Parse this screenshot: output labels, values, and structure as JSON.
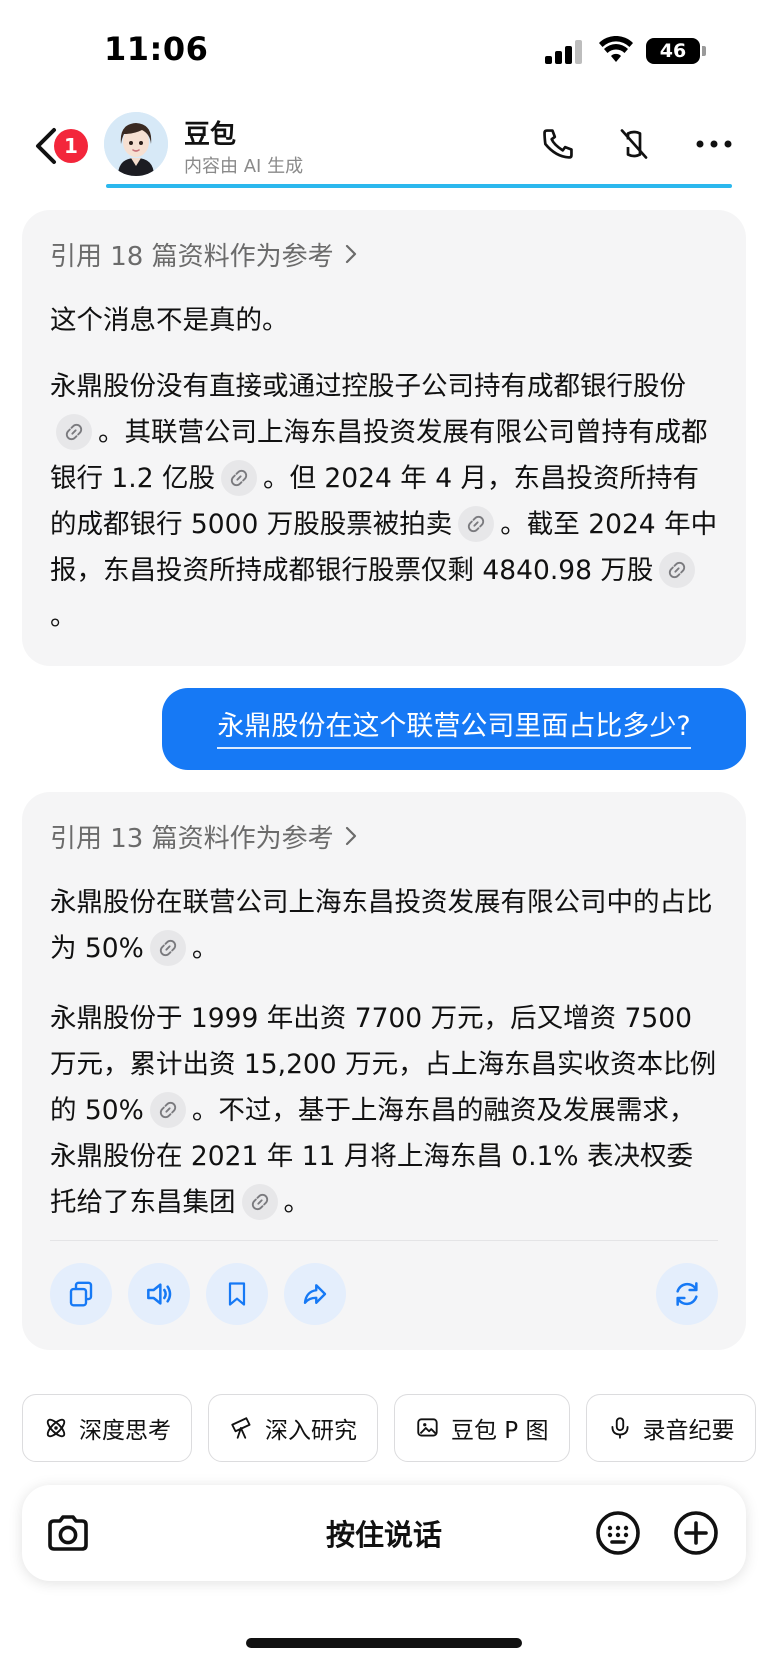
{
  "status_bar": {
    "time": "11:06",
    "battery": "46"
  },
  "header": {
    "unread_count": "1",
    "bot_name": "豆包",
    "subtitle": "内容由 AI 生成"
  },
  "messages": [
    {
      "role": "assistant",
      "reference": "引用 18 篇资料作为参考",
      "paragraphs": [
        {
          "segments": [
            "这个消息不是真的。"
          ]
        },
        {
          "segments": [
            "永鼎股份没有直接或通过控股子公司持有成都银行股份",
            "。其联营公司上海东昌投资发展有限公司曾持有成都银行 1.2 亿股",
            "。但 2024 年 4 月，东昌投资所持有的成都银行 5000 万股股票被拍卖",
            "。截至 2024 年中报，东昌投资所持成都银行股票仅剩 4840.98 万股",
            "。"
          ]
        }
      ]
    },
    {
      "role": "user",
      "text": "永鼎股份在这个联营公司里面占比多少?"
    },
    {
      "role": "assistant",
      "reference": "引用 13 篇资料作为参考",
      "paragraphs": [
        {
          "segments": [
            "永鼎股份在联营公司上海东昌投资发展有限公司中的占比为 50%",
            "。"
          ]
        },
        {
          "segments": [
            "永鼎股份于 1999 年出资 7700 万元，后又增资 7500 万元，累计出资 15,200 万元，占上海东昌实收资本比例的 50%",
            "。不过，基于上海东昌的融资及发展需求，永鼎股份在 2021 年 11 月将上海东昌 0.1% 表决权委托给了东昌集团",
            "。"
          ]
        }
      ]
    }
  ],
  "quick_tools": [
    "深度思考",
    "深入研究",
    "豆包 P 图",
    "录音纪要"
  ],
  "input_bar": {
    "hold_to_talk": "按住说话"
  },
  "colors": {
    "accent": "#1679f5",
    "bubble_bg": "#f5f5f6",
    "badge": "#f3263b",
    "progress": "#2bb8ee"
  },
  "icons": [
    "back-icon",
    "phone-icon",
    "mute-icon",
    "more-icon",
    "link-icon",
    "copy-icon",
    "speaker-icon",
    "bookmark-icon",
    "share-icon",
    "regenerate-icon",
    "atom-icon",
    "telescope-icon",
    "image-edit-icon",
    "mic-icon",
    "camera-icon",
    "keypad-icon",
    "plus-icon"
  ]
}
